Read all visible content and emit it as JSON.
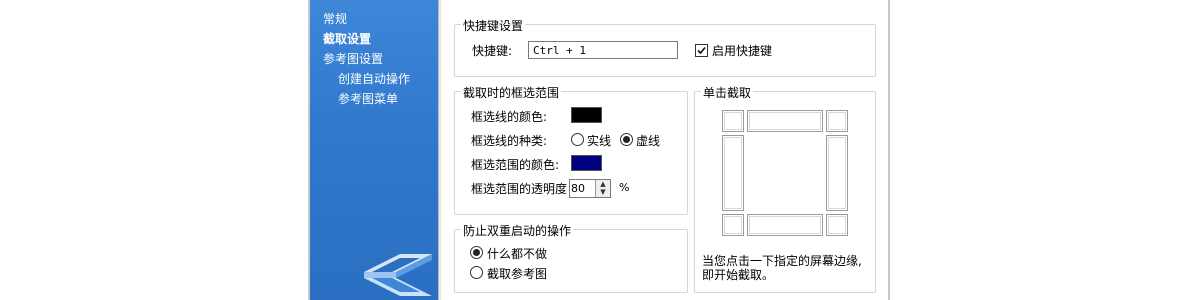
{
  "sidebar": {
    "items": [
      {
        "label": "常规",
        "active": false
      },
      {
        "label": "截取设置",
        "active": true
      },
      {
        "label": "参考图设置",
        "active": false
      },
      {
        "label": "创建自动操作",
        "active": false
      },
      {
        "label": "参考图菜单",
        "active": false
      }
    ]
  },
  "hotkey_group": {
    "title": "快捷键设置",
    "label": "快捷键:",
    "value": "Ctrl + 1",
    "enable_label": "启用快捷键",
    "enable_checked": true
  },
  "selection_group": {
    "title": "截取时的框选范围",
    "line_color_label": "框选线的颜色:",
    "line_color": "#000000",
    "line_type_label": "框选线的种类:",
    "line_type_solid": "实线",
    "line_type_dashed": "虚线",
    "line_type_selected": "dashed",
    "area_color_label": "框选范围的颜色:",
    "area_color": "#000080",
    "opacity_label": "框选范围的透明度",
    "opacity_value": "80",
    "opacity_unit": "%"
  },
  "single_click_group": {
    "title": "单击截取",
    "description_line1": "当您点击一下指定的屏幕边缘,",
    "description_line2": "即开始截取。"
  },
  "double_launch_group": {
    "title": "防止双重启动的操作",
    "option_none": "什么都不做",
    "option_capture": "截取参考图",
    "selected": "none"
  },
  "icons": {
    "logo": "app-logo",
    "check": "check-icon",
    "spin_up": "arrow-up-icon",
    "spin_down": "arrow-down-icon"
  }
}
